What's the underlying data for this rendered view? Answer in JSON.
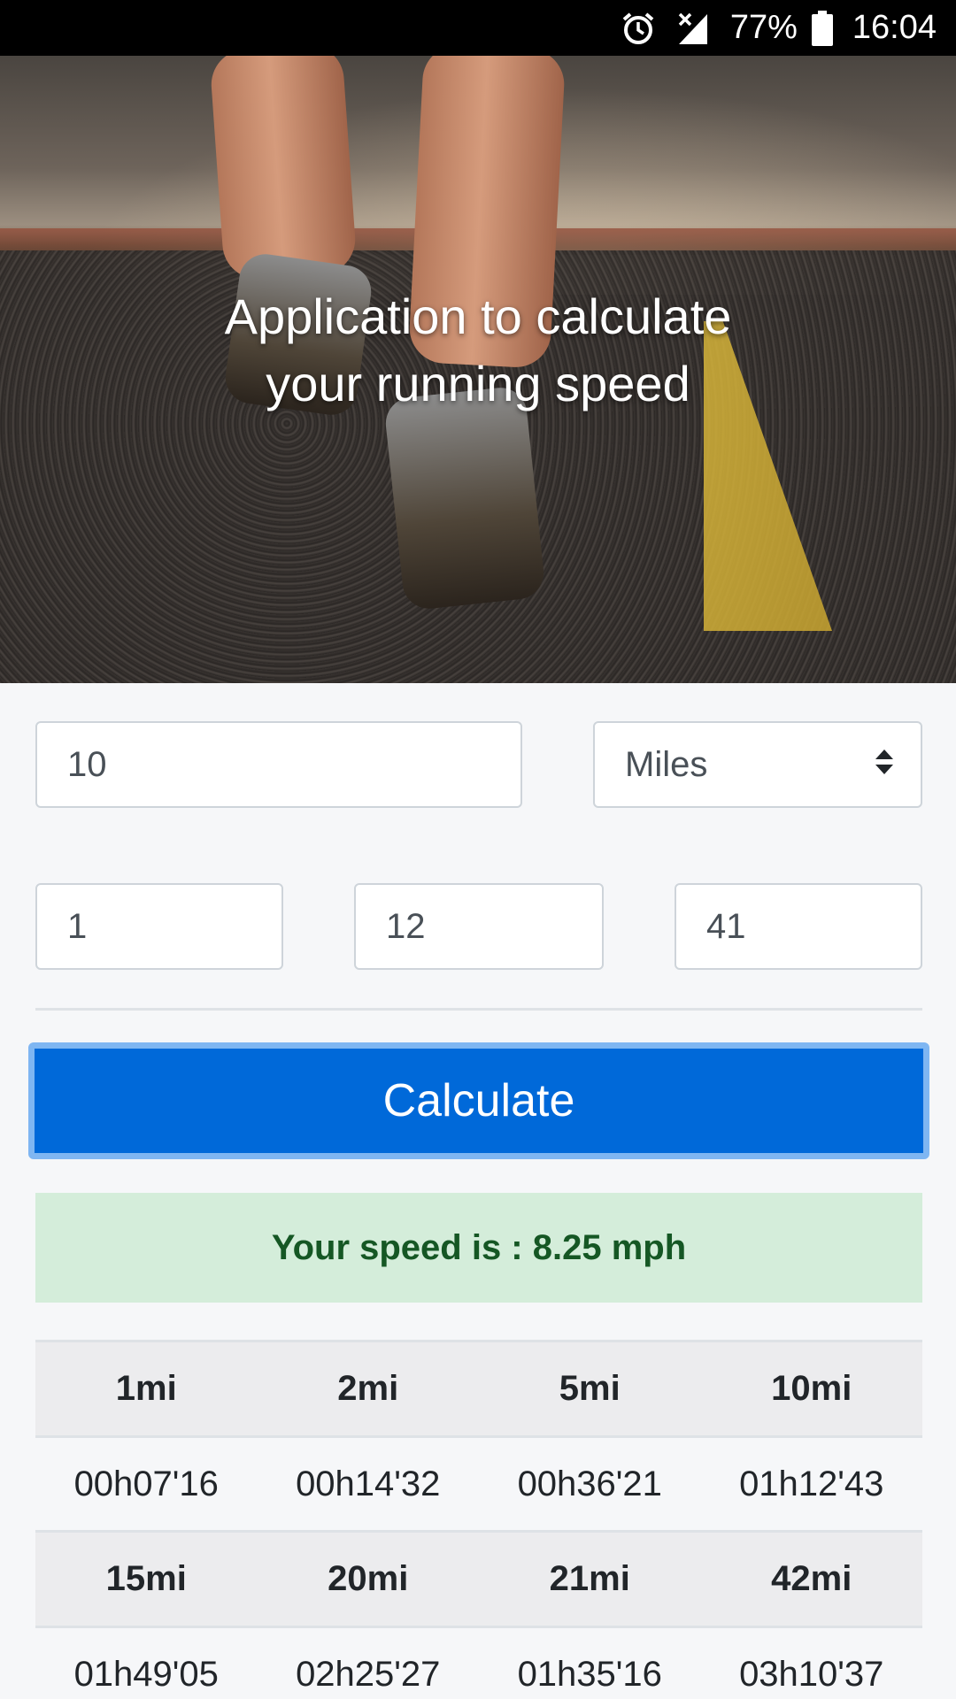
{
  "status_bar": {
    "battery": "77%",
    "time": "16:04",
    "icons": [
      "alarm-icon",
      "no-signal-icon",
      "battery-icon"
    ]
  },
  "hero": {
    "title_line1": "Application to calculate",
    "title_line2": "your running speed"
  },
  "form": {
    "distance_value": "10",
    "unit_selected": "Miles",
    "hours_value": "1",
    "minutes_value": "12",
    "seconds_value": "41"
  },
  "button": {
    "calculate_label": "Calculate"
  },
  "result": {
    "text": "Your speed is : 8.25 mph"
  },
  "table": {
    "rows": [
      {
        "distances": [
          "1mi",
          "2mi",
          "5mi",
          "10mi"
        ],
        "times": [
          "00h07'16",
          "00h14'32",
          "00h36'21",
          "01h12'43"
        ]
      },
      {
        "distances": [
          "15mi",
          "20mi",
          "21mi",
          "42mi"
        ],
        "times": [
          "01h49'05",
          "02h25'27",
          "01h35'16",
          "03h10'37"
        ]
      }
    ]
  },
  "colors": {
    "primary": "#0069d9",
    "success_bg": "#d4edda",
    "success_text": "#155724"
  }
}
